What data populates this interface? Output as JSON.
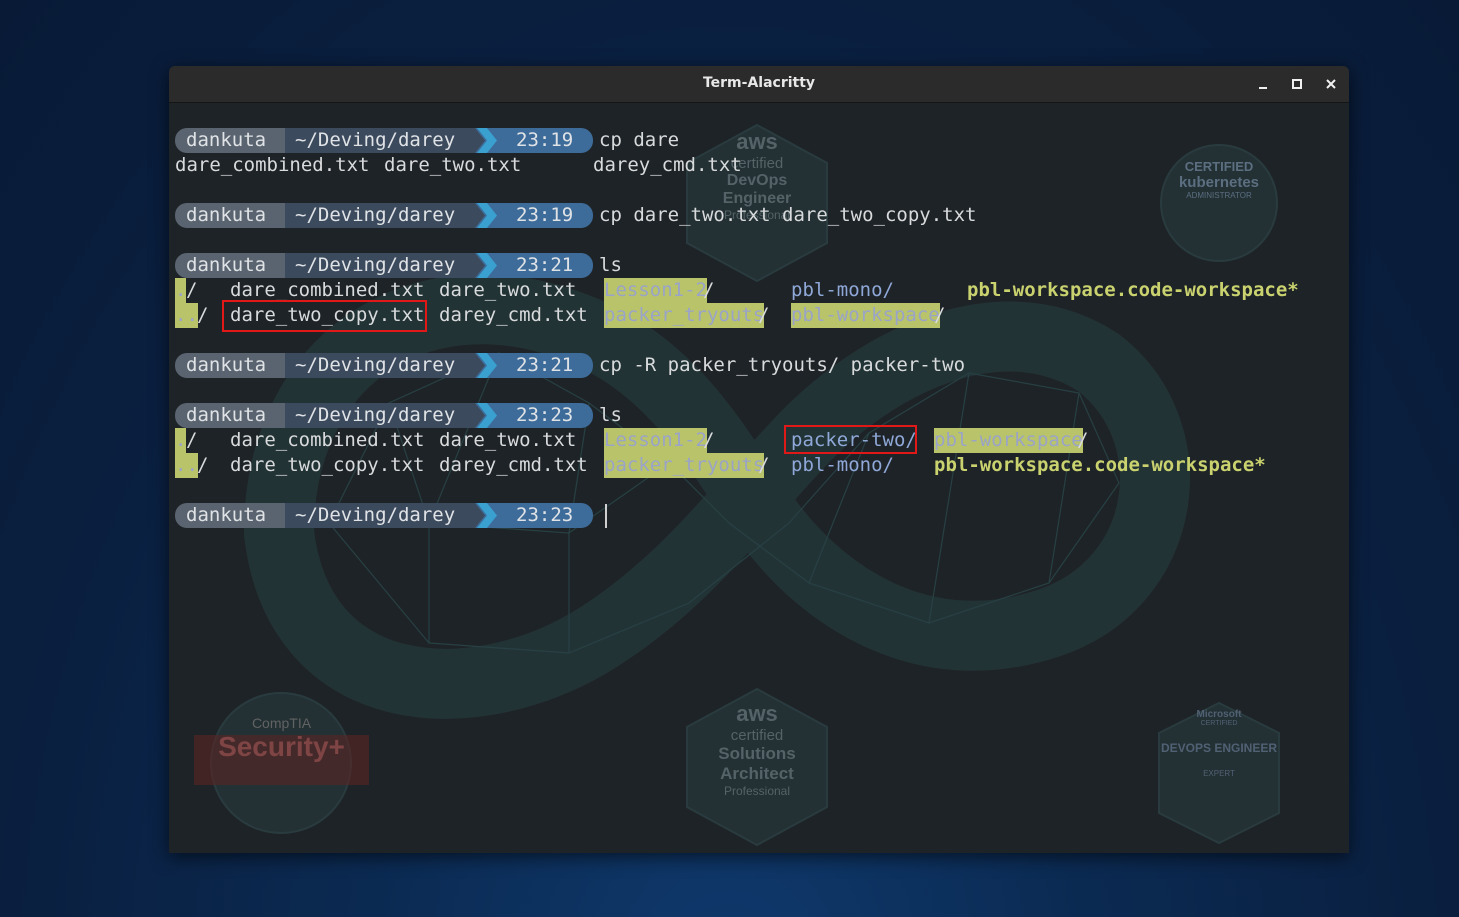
{
  "window": {
    "title": "Term-Alacritty",
    "minimize_icon": "minimize-icon",
    "maximize_icon": "maximize-icon",
    "close_icon": "close-icon"
  },
  "prompt": {
    "user": "dankuta",
    "path": "~/Deving/darey"
  },
  "blocks": [
    {
      "time": "23:19",
      "command": "cp dare"
    },
    {
      "time": "23:19",
      "command": "cp dare_two.txt dare_two_copy.txt"
    },
    {
      "time": "23:21",
      "command": "ls"
    },
    {
      "time": "23:21",
      "command": "cp -R packer_tryouts/ packer-two"
    },
    {
      "time": "23:23",
      "command": "ls"
    },
    {
      "time": "23:23",
      "command": ""
    }
  ],
  "completion": [
    "dare_combined.txt",
    "dare_two.txt",
    "darey_cmd.txt"
  ],
  "ls1": {
    "row1": [
      ".",
      "/",
      "dare_combined.txt",
      "dare_two.txt",
      "Lesson1-2",
      "/",
      "pbl-mono/",
      "pbl-workspace.code-workspace*"
    ],
    "row2": [
      "..",
      "/",
      "dare_two_copy.txt",
      "darey_cmd.txt",
      "packer_tryouts",
      "/",
      "pbl-workspace",
      "/"
    ]
  },
  "ls2": {
    "row1": [
      ".",
      "/",
      "dare_combined.txt",
      "dare_two.txt",
      "Lesson1-2",
      "/",
      "packer-two/",
      "pbl-workspace",
      "/"
    ],
    "row2": [
      "..",
      "/",
      "dare_two_copy.txt",
      "darey_cmd.txt",
      "packer_tryouts",
      "/",
      "pbl-mono/",
      "pbl-workspace.code-workspace*"
    ]
  },
  "wallpaper": {
    "badges": [
      {
        "brand": "aws",
        "line1": "certified",
        "line2": "DevOps",
        "line3": "Engineer",
        "line4": "Professional"
      },
      {
        "brand": "aws",
        "line1": "certified",
        "line2": "Solutions",
        "line3": "Architect",
        "line4": "Professional"
      },
      {
        "line1": "CERTIFIED",
        "line2": "kubernetes",
        "line3": "ADMINISTRATOR"
      },
      {
        "line1": "CompTIA",
        "line2": "Security+"
      },
      {
        "line1": "Microsoft",
        "line2": "CERTIFIED",
        "line3": "DEVOPS ENGINEER",
        "line4": "EXPERT"
      }
    ],
    "accent": "#3e8c8c"
  },
  "colors": {
    "highlight_bg": "#b9c46a",
    "highlight_fg": "#9aa3c8",
    "directory": "#8fa8d8",
    "executable": "#c9d26e",
    "annotation_box": "#e01818"
  }
}
